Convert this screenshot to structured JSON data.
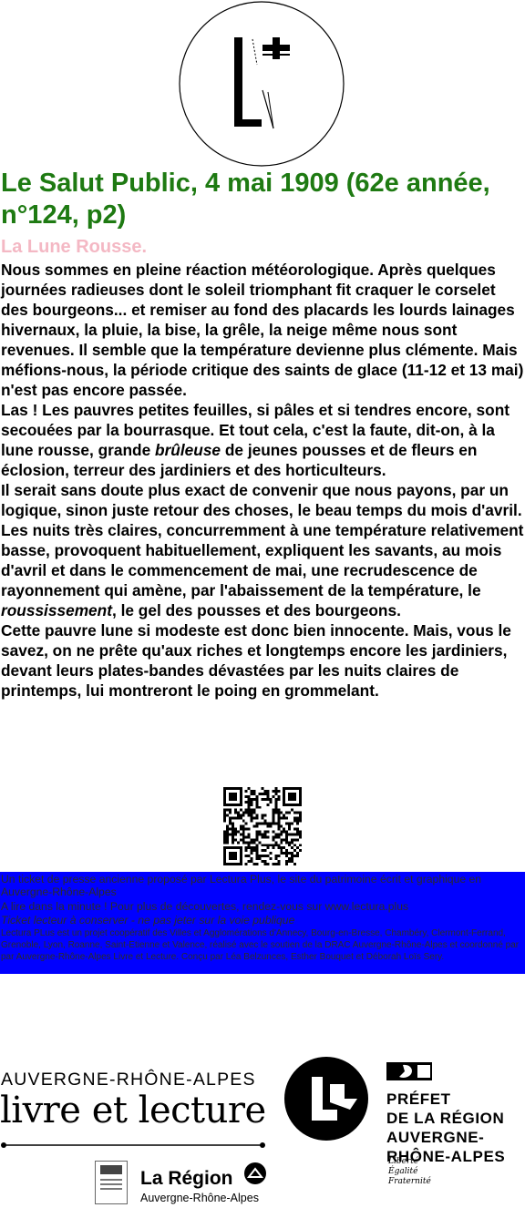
{
  "header": {
    "logo_icon": "lectura-plus-l-logo-icon",
    "title": "Le Salut Public, 4 mai 1909 (62e année, n°124, p2)",
    "subtitle": "La Lune Rousse."
  },
  "article": {
    "p1": "Nous sommes en pleine réaction météorologique. Après quelques journées radieuses dont le soleil triomphant fit craquer le corselet des bourgeons... et remiser au fond des placards les lourds lainages hivernaux, la pluie, la bise, la grêle, la neige même nous sont revenues. Il semble que la température devienne plus clémente. Mais méfions-nous, la période critique des saints de glace (11-12 et 13 mai) n'est pas encore passée.",
    "p2_before": "Las ! Les pauvres petites feuilles, si pâles et si tendres encore, sont secouées par la bourrasque. Et tout cela, c'est la faute, dit-on, à la lune rousse, grande ",
    "p2_italic": "brûleuse",
    "p2_after": " de jeunes pousses et de fleurs en éclosion, terreur des jardiniers et des horticulteurs.",
    "p3_before": "Il serait sans doute plus exact de convenir que nous payons, par un logique, sinon juste retour des choses, le beau temps du mois d'avril. Les nuits très claires, concurremment à une température relativement basse, provoquent habituellement, expliquent les savants, au mois d'avril et dans le commencement de mai, une recrudescence de rayonnement qui amène, par l'abaissement de la température, le ",
    "p3_italic": "roussissement",
    "p3_after": ", le gel des pousses et des bourgeons.",
    "p4": "Cette pauvre lune si modeste est donc bien innocente. Mais, vous le savez, on ne prête qu'aux riches et longtemps encore les jardiniers, devant leurs plates-bandes dévastées par les nuits claires de printemps, lui montreront le poing en grommelant."
  },
  "qr_icon": "qr-code-icon",
  "footer": {
    "line1": "Un ticket de presse ancienne proposé par Lectura Plus, le site du patrimoine écrit et graphique en Auvergne-Rhône-Alpes",
    "line2": "A lire dans la minute ! Pour plus de découvertes, rendez-vous sur www.lectura.plus",
    "line3": "Ticket lecteur à conserver - ne pas jeter sur la voie publique",
    "line4": "Lectura PLus est un projet coopératif des Villes et Agglomérations d'Annecy, Bourg-en-Bresse, Chambéry, Clermont-Ferrand, Grenoble, Lyon, Roanne, Saint-Etienne et Valence, réalisé avec le soutien de la DRAC Auvergne-Rhône-Alpes et coordonné par par Auvergne-Rhône-Alpes Livre et Lecture. Conçu par Léa Belzunces, Esther Bouquet et Déborah Loïs Sery.",
    "bg_color": "#0000ff"
  },
  "partners": {
    "arl_name": "AUVERGNE-RHÔNE-ALPES",
    "arl_title": "livre et lecture",
    "prefet": "PRÉFET\nDE LA RÉGION\nAUVERGNE-\nRHÔNE-ALPES",
    "devise": "Liberté\nÉgalité\nFraternité",
    "region": "La Région",
    "region_sub": "Auvergne-Rhône-Alpes",
    "brand_color": "#1e7a12",
    "subtitle_color": "#f4b8c4"
  }
}
